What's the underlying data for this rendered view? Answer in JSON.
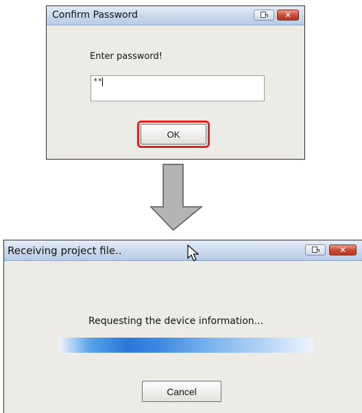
{
  "confirm_dialog": {
    "title": "Confirm Password",
    "prompt": "Enter password!",
    "password_value": "**",
    "ok_label": "OK",
    "close_glyph": "✕"
  },
  "receiving_dialog": {
    "title": "Receiving project file..",
    "status": "Requesting the device information...",
    "cancel_label": "Cancel",
    "close_glyph": "✕"
  },
  "annotations": {
    "highlight_color": "#e0221c",
    "arrow_color": "#b4b4b4",
    "arrow_direction": "down"
  }
}
